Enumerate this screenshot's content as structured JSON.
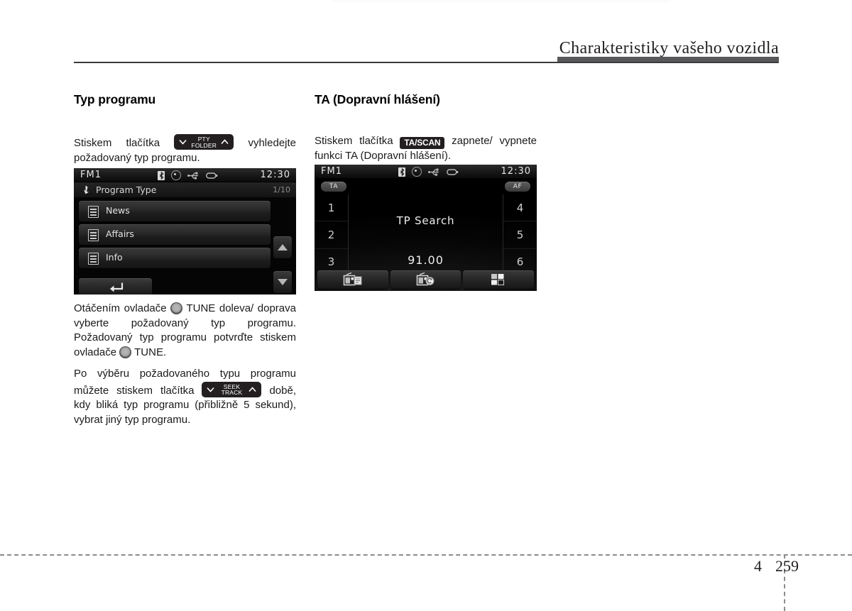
{
  "header": {
    "title": "Charakteristiky vašeho vozidla"
  },
  "left_column": {
    "section_title": "Typ programu",
    "para1_before": "Stiskem tlačítka",
    "key_pty": {
      "line1": "PTY",
      "line2": "FOLDER",
      "icon_left": "chevron-down-icon",
      "icon_right": "chevron-up-icon"
    },
    "para1_after": "vyhledejte požadovaný typ programu.",
    "para2_part1": "Otáčením ovladače",
    "para2_knob1": "tune-knob-icon",
    "para2_part2": "TUNE doleva/ doprava vyberte požadovaný typ programu. Požadovaný typ programu potvrďte stiskem ovladače",
    "para2_knob2": "tune-knob-icon",
    "para2_part3": "TUNE.",
    "para3_part1": "Po výběru požadovaného typu programu můžete stiskem tlačítka",
    "key_seek": {
      "line1": "SEEK",
      "line2": "TRACK",
      "icon_left": "chevron-down-icon",
      "icon_right": "chevron-up-icon"
    },
    "para3_part2": "době, kdy bliká typ programu (přibližně 5 sekund), vybrat jiný typ programu."
  },
  "right_column": {
    "section_title": "TA (Dopravní hlášení)",
    "para1_before": "Stiskem tlačítka",
    "key_tascan": "TA/SCAN",
    "para1_after": "zapnete/ vypnete funkci TA (Dopravní hlášení)."
  },
  "screen_left": {
    "statusbar": {
      "source": "FM1",
      "clock": "12:30",
      "icons": [
        "bluetooth-icon",
        "disc-icon",
        "usb-icon",
        "aux-icon"
      ]
    },
    "list_title": "Program Type",
    "list_count": "1/10",
    "cursor_icon": "pointer-icon",
    "items": [
      {
        "label": "News",
        "icon": "list-item-icon"
      },
      {
        "label": "Affairs",
        "icon": "list-item-icon"
      },
      {
        "label": "Info",
        "icon": "list-item-icon"
      }
    ],
    "scroll_up_icon": "triangle-up-icon",
    "scroll_down_icon": "triangle-down-icon",
    "back_icon": "return-arrow-icon"
  },
  "screen_right": {
    "statusbar": {
      "source": "FM1",
      "clock": "12:30",
      "icons": [
        "bluetooth-icon",
        "disc-icon",
        "usb-icon",
        "aux-icon"
      ]
    },
    "badge_ta": "TA",
    "badge_af": "AF",
    "presets_left": [
      "1",
      "2",
      "3"
    ],
    "presets_right": [
      "4",
      "5",
      "6"
    ],
    "center_status": "TP Search",
    "frequency": "91.00",
    "softkeys": [
      "radio-list-icon",
      "radio-scan-icon",
      "preset-grid-icon"
    ]
  },
  "footer": {
    "chapter": "4",
    "page": "259"
  },
  "colors": {
    "header_bar": "#58585a",
    "text": "#231f20",
    "screen_bg": "#000000",
    "key_bg": "#231f20"
  }
}
